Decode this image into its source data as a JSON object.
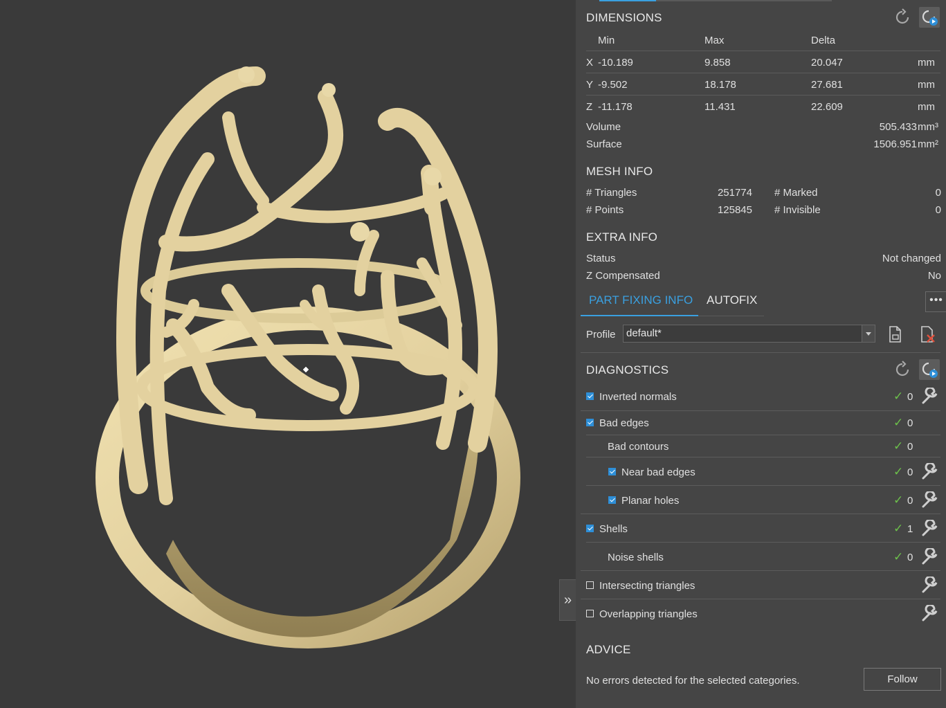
{
  "dimensions": {
    "title": "DIMENSIONS",
    "headers": {
      "min": "Min",
      "max": "Max",
      "delta": "Delta"
    },
    "rows": [
      {
        "axis": "X",
        "min": "-10.189",
        "max": "9.858",
        "delta": "20.047",
        "unit": "mm"
      },
      {
        "axis": "Y",
        "min": "-9.502",
        "max": "18.178",
        "delta": "27.681",
        "unit": "mm"
      },
      {
        "axis": "Z",
        "min": "-11.178",
        "max": "11.431",
        "delta": "22.609",
        "unit": "mm"
      }
    ],
    "volume_label": "Volume",
    "volume_value": "505.433",
    "volume_unit": "mm³",
    "surface_label": "Surface",
    "surface_value": "1506.951",
    "surface_unit": "mm²"
  },
  "mesh_info": {
    "title": "MESH INFO",
    "triangles_label": "# Triangles",
    "triangles_value": "251774",
    "points_label": "# Points",
    "points_value": "125845",
    "marked_label": "# Marked",
    "marked_value": "0",
    "invisible_label": "# Invisible",
    "invisible_value": "0"
  },
  "extra_info": {
    "title": "EXTRA INFO",
    "status_label": "Status",
    "status_value": "Not changed",
    "zcomp_label": "Z Compensated",
    "zcomp_value": "No"
  },
  "tabs": {
    "part_fixing": "PART FIXING INFO",
    "autofix": "AUTOFIX",
    "more": "•••"
  },
  "profile": {
    "label": "Profile",
    "value": "default*"
  },
  "diagnostics": {
    "title": "DIAGNOSTICS",
    "items": [
      {
        "label": "Inverted normals",
        "checked": true,
        "count": "0"
      },
      {
        "label": "Bad edges",
        "checked": true,
        "count": "0"
      },
      {
        "label": "Bad contours",
        "count": "0"
      },
      {
        "label": "Near bad edges",
        "checked": true,
        "count": "0"
      },
      {
        "label": "Planar holes",
        "checked": true,
        "count": "0"
      },
      {
        "label": "Shells",
        "checked": true,
        "count": "1"
      },
      {
        "label": "Noise shells",
        "count": "0"
      },
      {
        "label": "Intersecting triangles",
        "checked": false
      },
      {
        "label": "Overlapping triangles",
        "checked": false
      }
    ]
  },
  "advice": {
    "title": "ADVICE",
    "message": "No errors detected for the selected categories.",
    "follow_label": "Follow"
  },
  "collapse_glyph": "»",
  "colors": {
    "accent": "#3aa0e0",
    "ok": "#6cc04a",
    "model": "#e3d19f",
    "viewport_bg": "#3a3a3a",
    "panel_bg": "#454545"
  }
}
